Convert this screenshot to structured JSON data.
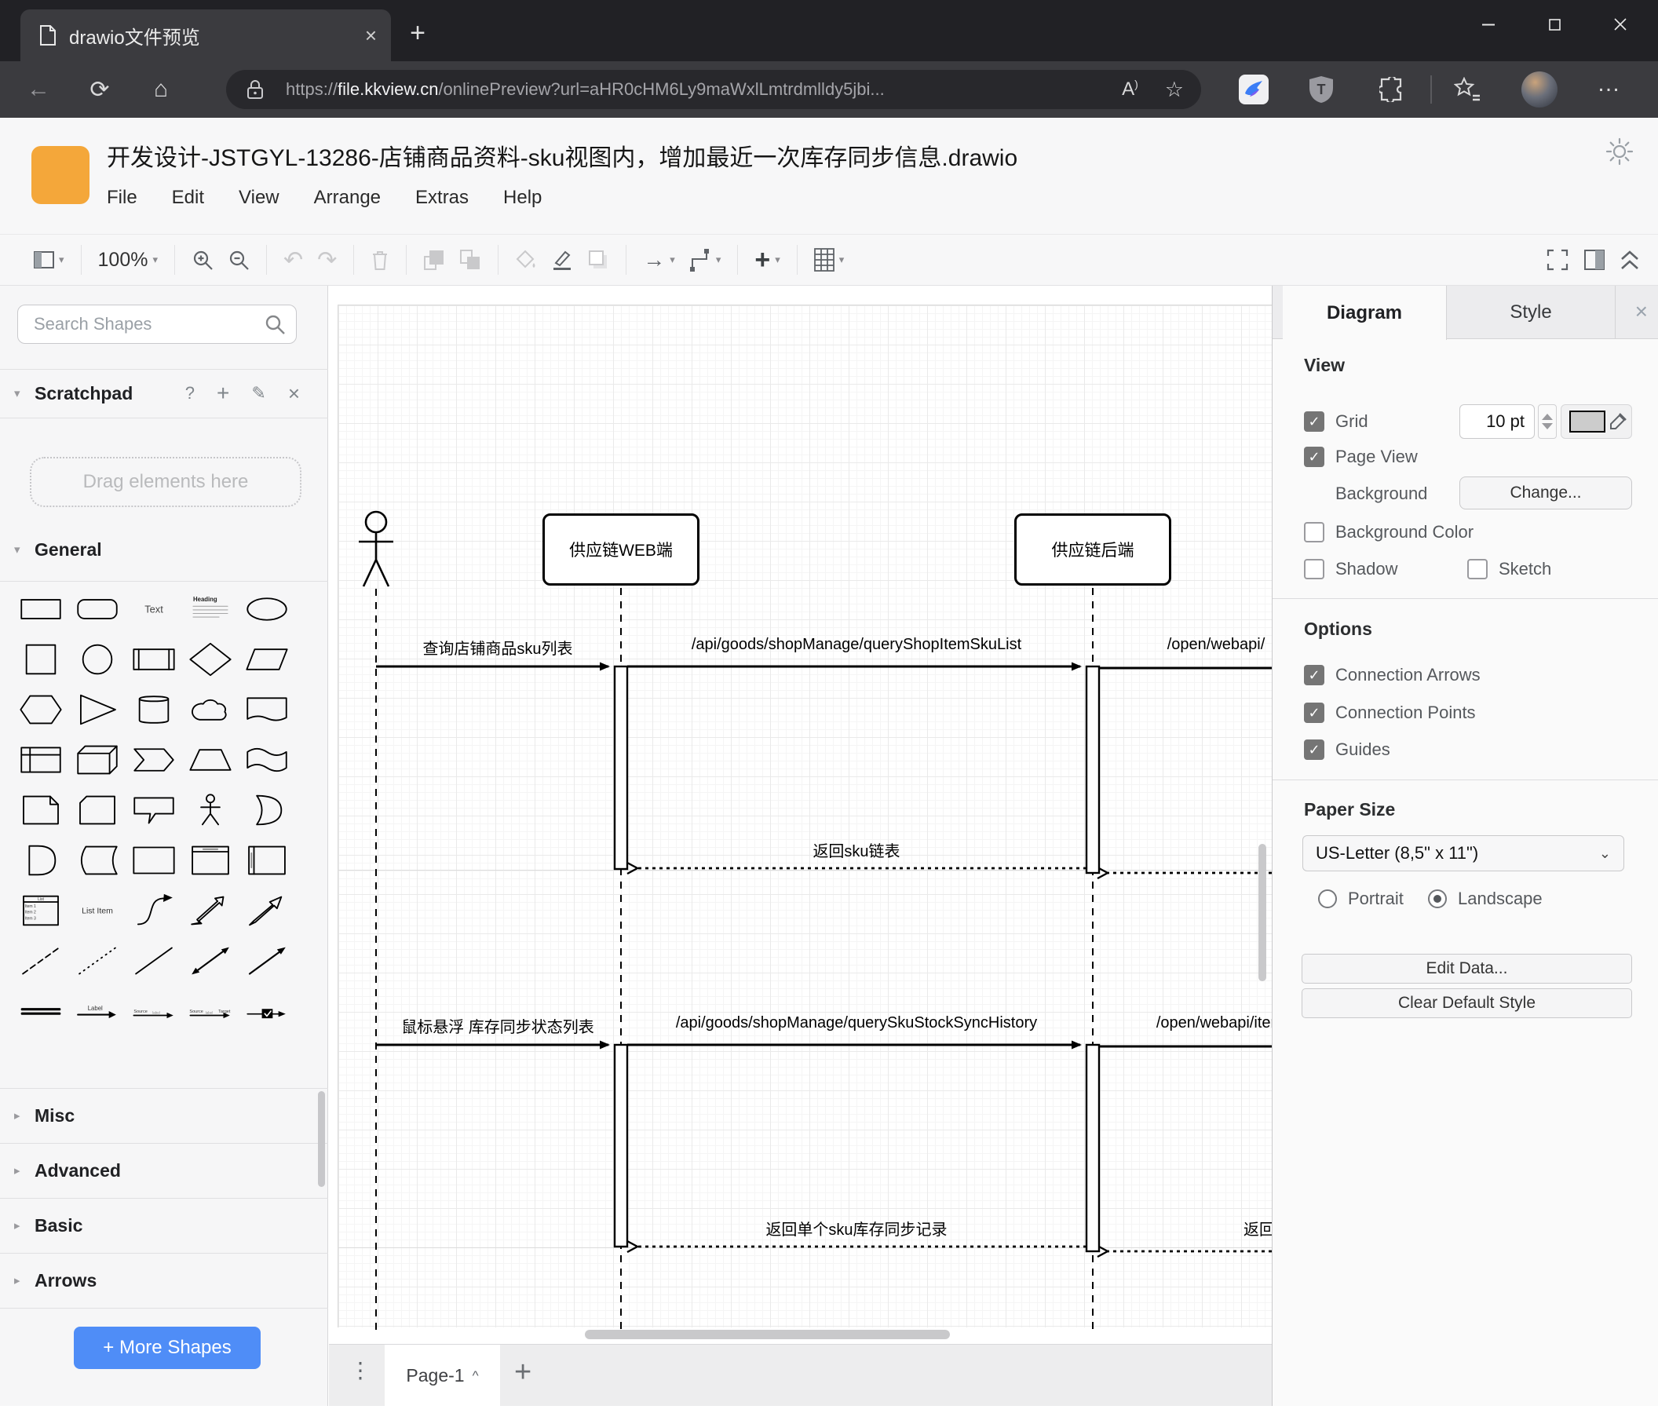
{
  "browser": {
    "tab_title": "drawio文件预览",
    "url": {
      "scheme": "https://",
      "domain": "file.kkview.cn",
      "path": "/onlinePreview?url=aHR0cHM6Ly9maWxlLmtrdmlldy5jbi..."
    }
  },
  "app": {
    "title": "开发设计-JSTGYL-13286-店铺商品资料-sku视图内，增加最近一次库存同步信息.drawio",
    "menus": [
      "File",
      "Edit",
      "View",
      "Arrange",
      "Extras",
      "Help"
    ],
    "zoom_level": "100%"
  },
  "sidebar": {
    "search_placeholder": "Search Shapes",
    "scratchpad_title": "Scratchpad",
    "scratchpad_hint": "Drag elements here",
    "sections": {
      "general": "General",
      "misc": "Misc",
      "advanced": "Advanced",
      "basic": "Basic",
      "arrows": "Arrows"
    },
    "more_shapes_label": "+ More Shapes",
    "shapes": [
      "rectangle",
      "rounded-rectangle",
      "text",
      "heading",
      "ellipse",
      "square",
      "circle",
      "process",
      "diamond",
      "parallelogram",
      "hexagon",
      "triangle",
      "cylinder",
      "cloud",
      "document",
      "internal-storage",
      "cube",
      "step",
      "trapezoid",
      "tape",
      "note",
      "card",
      "callout",
      "actor",
      "or",
      "and",
      "data-storage",
      "container",
      "vertical-container",
      "horizontal-container",
      "list",
      "list-item",
      "curve",
      "bidirectional-arrow",
      "arrow",
      "dashed-line",
      "dotted-line",
      "line",
      "bidirectional-connector",
      "directional-connector",
      "link",
      "label-arrow",
      "source-label-arrow",
      "source-target-arrow",
      "symbol-arrow"
    ],
    "shape_texts": {
      "text": "Text",
      "heading": "Heading",
      "list": "List",
      "list_items": [
        "Item 1",
        "Item 2",
        "Item 3"
      ],
      "list_item": "List Item",
      "label": "Label",
      "label_lc": "label",
      "source": "Source",
      "target": "Target"
    }
  },
  "canvas": {
    "lifelines": [
      "供应链WEB端",
      "供应链后端"
    ],
    "messages": [
      {
        "label": "查询店铺商品sku列表",
        "type": "solid"
      },
      {
        "label": "/api/goods/shopManage/queryShopItemSkuList",
        "type": "solid"
      },
      {
        "label": "/open/webapi/",
        "type": "solid"
      },
      {
        "label": "返回sku链表",
        "type": "dashed"
      },
      {
        "label": "鼠标悬浮 库存同步状态列表",
        "type": "solid"
      },
      {
        "label": "/api/goods/shopManage/querySkuStockSyncHistory",
        "type": "solid"
      },
      {
        "label": "/open/webapi/item",
        "type": "solid"
      },
      {
        "label": "返回单个sku库存同步记录",
        "type": "dashed"
      },
      {
        "label": "返回",
        "type": "dashed"
      }
    ],
    "page_tab": "Page-1"
  },
  "panel": {
    "tabs": {
      "diagram": "Diagram",
      "style": "Style"
    },
    "view": {
      "heading": "View",
      "grid": "Grid",
      "grid_size": "10 pt",
      "page_view": "Page View",
      "background": "Background",
      "change": "Change...",
      "background_color": "Background Color",
      "shadow": "Shadow",
      "sketch": "Sketch"
    },
    "options": {
      "heading": "Options",
      "connection_arrows": "Connection Arrows",
      "connection_points": "Connection Points",
      "guides": "Guides"
    },
    "paper": {
      "heading": "Paper Size",
      "size_value": "US-Letter (8,5\" x 11\")",
      "portrait": "Portrait",
      "landscape": "Landscape"
    },
    "edit_data": "Edit Data...",
    "clear_default_style": "Clear Default Style"
  },
  "icons": {
    "close": "×",
    "plus": "+",
    "help": "?",
    "back": "←",
    "reload": "⟳",
    "home": "⌂",
    "star": "☆",
    "undo": "↶",
    "redo": "↷",
    "arrow_right": "→",
    "caret_down": "▾",
    "caret_right": "▸",
    "caret_up": "^",
    "dots_v": "⋮",
    "dots_h": "…",
    "minimize": "—",
    "pencil": "✎",
    "a_read": "A",
    "a_read_sup": ")"
  },
  "colors": {
    "logo_orange": "#f4a73a",
    "accent_blue": "#4f8df7",
    "chrome_dark": "#212125",
    "toolbar_dark": "#3b3b3f"
  }
}
